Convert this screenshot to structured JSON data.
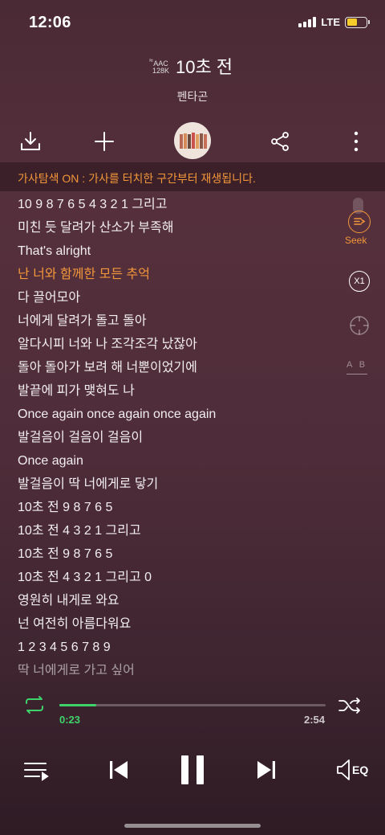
{
  "status_bar": {
    "time": "12:06",
    "network": "LTE",
    "battery_color": "#f5cc2a"
  },
  "song": {
    "title": "10초 전",
    "artist": "펜타곤",
    "quality": {
      "codec": "AAC",
      "bitrate": "128K"
    }
  },
  "actions": {
    "download_icon": "download-icon",
    "add_icon": "plus-icon",
    "album_art": "album-art",
    "share_icon": "share-icon",
    "more_icon": "more-icon"
  },
  "notice": "가사탐색 ON : 가사를 터치한 구간부터 재생됩니다.",
  "lyrics": [
    "10 9 8 7 6 5 4 3 2 1 그리고",
    "미친 듯 달려가 산소가 부족해",
    "That's alright",
    "난 너와 함께한 모든 추억",
    "다 끌어모아",
    "너에게 달려가 돌고 돌아",
    "알다시피 너와 나 조각조각 났잖아",
    "돌아 돌아가 보려 해 너뿐이었기에",
    "발끝에 피가 맺혀도 나",
    "Once again once again once again",
    "발걸음이 걸음이 걸음이",
    "Once again",
    "발걸음이 딱 너에게로 닿기",
    "10초 전 9 8 7 6 5",
    "10초 전 4 3 2 1 그리고",
    "10초 전 9 8 7 6 5",
    "10초 전 4 3 2 1 그리고 0",
    "영원히 내게로 와요",
    "넌 여전히 아름다워요",
    "1 2 3 4 5 6 7 8 9",
    "딱 너에게로 가고 싶어"
  ],
  "active_lyric_index": 3,
  "side_tools": {
    "seek_label": "Seek",
    "speed_label": "X1",
    "ab_label": "A B"
  },
  "playback": {
    "elapsed": "0:23",
    "total": "2:54",
    "progress": 0.14,
    "accent_color": "#3ed36a"
  },
  "controls": {
    "eq_label": "EQ"
  },
  "colors": {
    "highlight": "#f2963a",
    "accent": "#3ed36a"
  }
}
